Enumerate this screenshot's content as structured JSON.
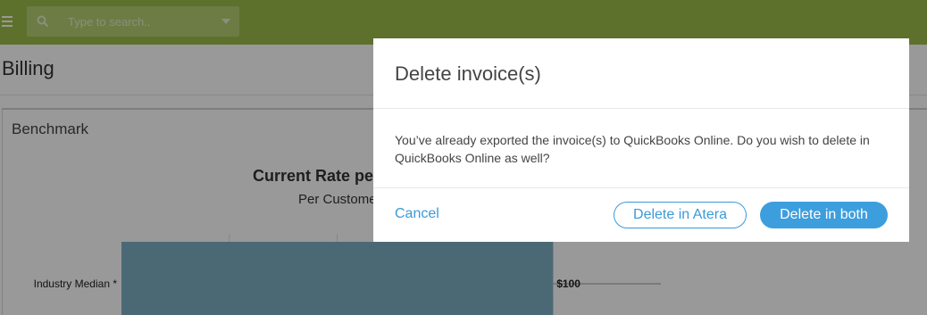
{
  "colors": {
    "topbar": "#9dbd4a",
    "accent": "#3a9ad9",
    "bar": "#7dafc4"
  },
  "topbar": {
    "menu_icon": "hamburger-icon",
    "search": {
      "icon": "search-icon",
      "placeholder": "Type to search..",
      "dropdown_icon": "caret-down-icon"
    }
  },
  "page": {
    "title": "Billing"
  },
  "panel": {
    "title": "Benchmark"
  },
  "chart_data": {
    "type": "bar",
    "orientation": "horizontal",
    "title": "Current Rate pe",
    "subtitle": "Per Custome",
    "categories": [
      "Industry Median *"
    ],
    "values": [
      100
    ],
    "value_labels": [
      "$100"
    ],
    "xlim": [
      0,
      125
    ],
    "grid": true
  },
  "modal": {
    "title": "Delete invoice(s)",
    "body": "You’ve already exported the invoice(s) to QuickBooks Online. Do you wish to delete in QuickBooks Online as well?",
    "cancel_label": "Cancel",
    "delete_atera_label": "Delete in Atera",
    "delete_both_label": "Delete in both"
  }
}
